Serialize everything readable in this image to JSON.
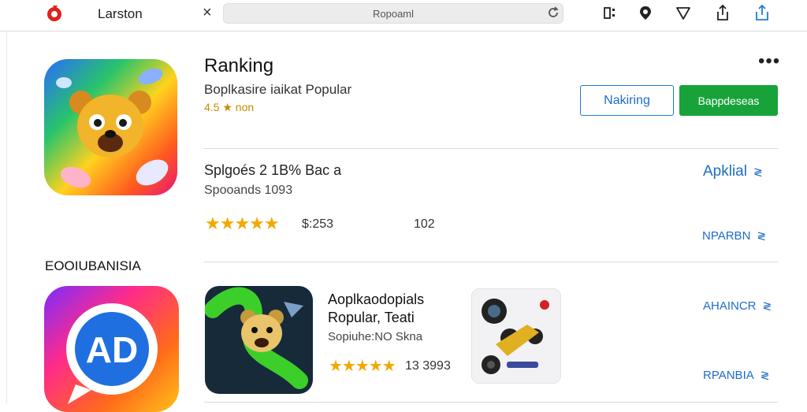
{
  "topbar": {
    "app_name": "Larston",
    "close_symbol": "×",
    "address_value": "Ropoaml",
    "icons": [
      "logo-icon",
      "close-icon",
      "reload-icon",
      "grid-icon",
      "location-pin-icon",
      "heart-icon",
      "share-icon",
      "upload-icon"
    ]
  },
  "hero": {
    "title": "Ranking",
    "subtitle": "Boplkasire iaikat Popular",
    "rating": "4.5 ★ non",
    "more_label": "•••",
    "outline_button_label": "Nakiring",
    "green_button_label": "Bappdeseas",
    "accent_blue": "#1e6cc8",
    "accent_green": "#18a33a"
  },
  "row1": {
    "title": "Splgoés 2 1B% Bac a",
    "subtitle": "Spooands 1093",
    "stars": "★★★★★",
    "price": "$:253",
    "count": "102",
    "link_top": "Apklial",
    "link_bottom": "NPARBN",
    "chevron": "≷"
  },
  "section": {
    "label": "EOOIUBANISIA"
  },
  "tiles": {
    "ad_icon_text": "AD",
    "title": "Aoplkaodopials Ropular, Teati",
    "subtitle": "Sopiuhe:NO Skna",
    "stars": "★★★★★",
    "count": "13 3993",
    "link_top": "AHAINCR",
    "link_bottom": "RPANBIA",
    "chevron": "≷"
  }
}
